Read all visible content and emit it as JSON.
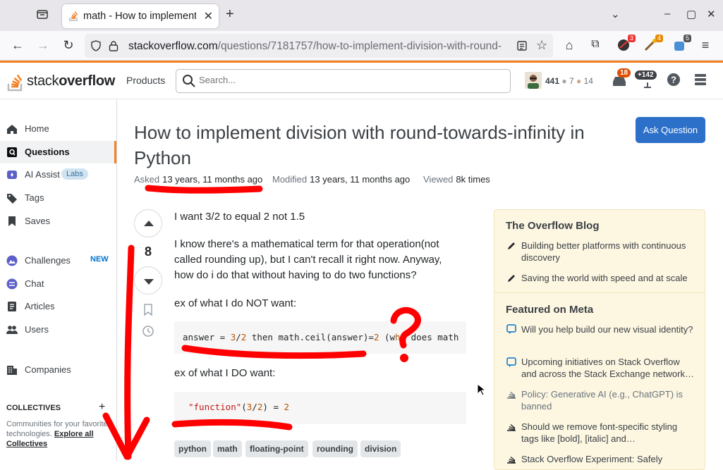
{
  "browser": {
    "tab_title": "math - How to implement division wi",
    "url_host": "stackoverflow.com",
    "url_path": "/questions/7181757/how-to-implement-division-with-round-",
    "ext_badges": [
      "3",
      "4",
      "5"
    ]
  },
  "so": {
    "logo_plain": "stack",
    "logo_bold": "overflow",
    "products": "Products",
    "search_placeholder": "Search...",
    "rep": "441",
    "silver": "7",
    "bronze": "14",
    "inbox_badge": "18",
    "achievements_badge": "+142"
  },
  "sidebar": {
    "items": [
      "Home",
      "Questions",
      "AI Assist",
      "Tags",
      "Saves",
      "Challenges",
      "Chat",
      "Articles",
      "Users",
      "Companies"
    ],
    "labs": "Labs",
    "new": "NEW",
    "collectives_heading": "COLLECTIVES",
    "collectives_text": "Communities for your favorite technologies.",
    "collectives_link": "Explore all Collectives"
  },
  "question": {
    "title": "How to implement division with round-towards-infinity in Python",
    "ask_button": "Ask Question",
    "asked_label": "Asked",
    "asked_value": "13 years, 11 months ago",
    "modified_label": "Modified",
    "modified_value": "13 years, 11 months ago",
    "viewed_label": "Viewed",
    "viewed_value": "8k times",
    "votes": "8",
    "p1": "I want 3/2 to equal 2 not 1.5",
    "p2": "I know there's a mathematical term for that operation(not called rounding up), but I can't recall it right now. Anyway, how do i do that without having to do two functions?",
    "p3": "ex of what I do NOT want:",
    "p4": "ex of what I DO want:",
    "tags": [
      "python",
      "math",
      "floating-point",
      "rounding",
      "division"
    ]
  },
  "blog": {
    "heading": "The Overflow Blog",
    "items": [
      "Building better platforms with continuous discovery",
      "Saving the world with speed and at scale"
    ],
    "meta_heading": "Featured on Meta",
    "meta_items": [
      "Will you help build our new visual identity?",
      "Upcoming initiatives on Stack Overflow and across the Stack Exchange network…",
      "Policy: Generative AI (e.g., ChatGPT) is banned",
      "Should we remove font-specific styling tags like [bold], [italic] and…",
      "Stack Overflow Experiment: Safely"
    ]
  },
  "colors": {
    "accent": "#f48024",
    "ask_button": "#2c70c9",
    "annotation": "#ff0000"
  }
}
